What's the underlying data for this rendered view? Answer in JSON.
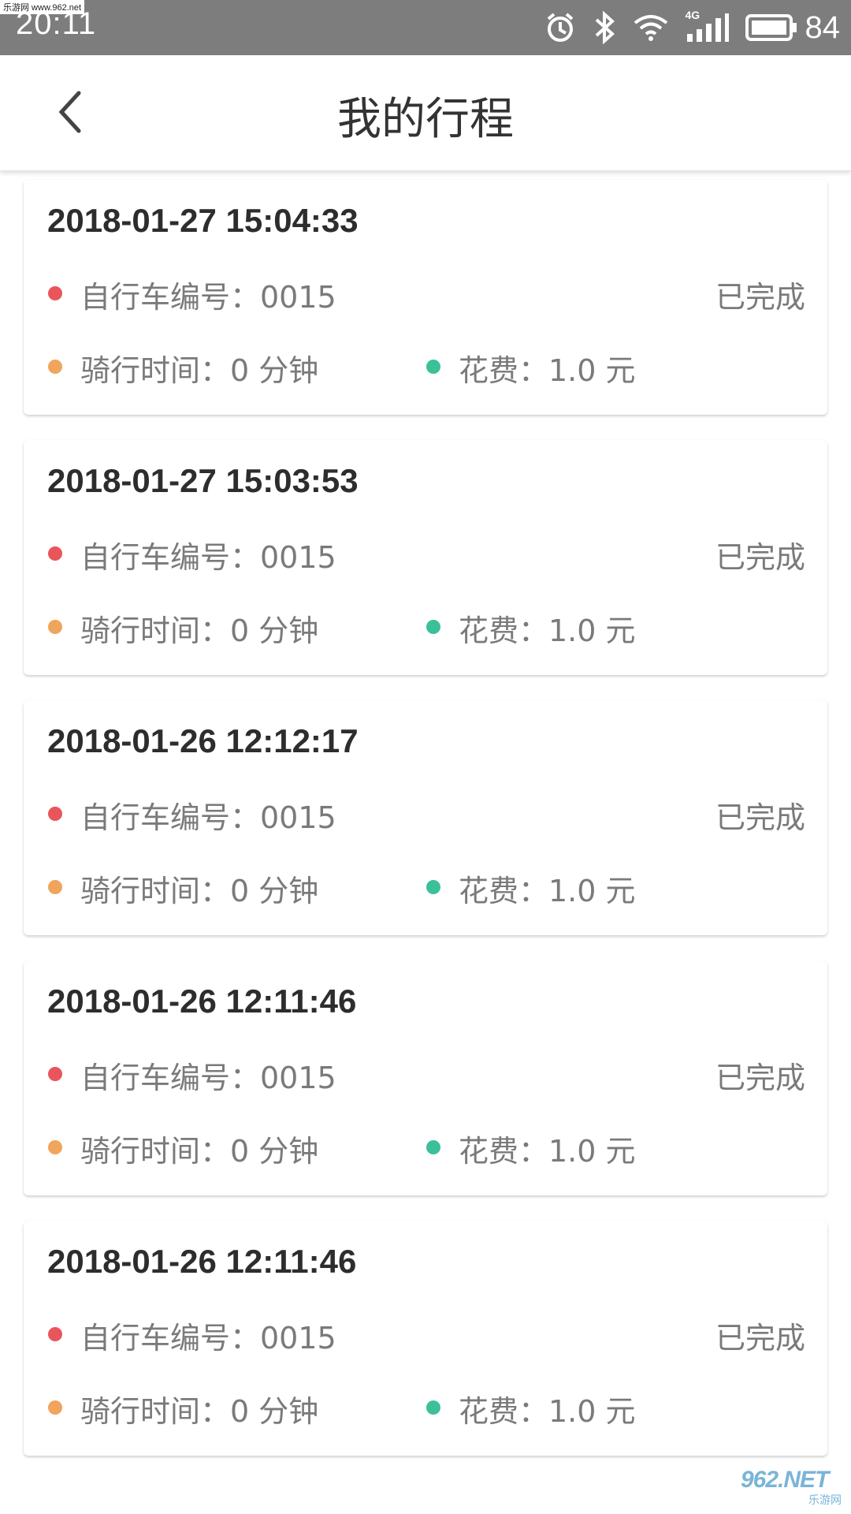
{
  "status_bar": {
    "time": "20:11",
    "battery_level": "84",
    "network_type": "4G",
    "icons": [
      "alarm-icon",
      "bluetooth-icon",
      "wifi-icon",
      "signal-icon",
      "battery-icon"
    ],
    "watermark": "乐游网 www.962.net"
  },
  "header": {
    "title": "我的行程",
    "back_icon": "chevron-left-icon"
  },
  "trips": [
    {
      "datetime": "2018-01-27 15:04:33",
      "bike_number": "自行车编号：0015",
      "status": "已完成",
      "duration": "骑行时间：0 分钟",
      "cost": "花费：1.0 元"
    },
    {
      "datetime": "2018-01-27 15:03:53",
      "bike_number": "自行车编号：0015",
      "status": "已完成",
      "duration": "骑行时间：0 分钟",
      "cost": "花费：1.0 元"
    },
    {
      "datetime": "2018-01-26 12:12:17",
      "bike_number": "自行车编号：0015",
      "status": "已完成",
      "duration": "骑行时间：0 分钟",
      "cost": "花费：1.0 元"
    },
    {
      "datetime": "2018-01-26 12:11:46",
      "bike_number": "自行车编号：0015",
      "status": "已完成",
      "duration": "骑行时间：0 分钟",
      "cost": "花费：1.0 元"
    },
    {
      "datetime": "2018-01-26 12:11:46",
      "bike_number": "自行车编号：0015",
      "status": "已完成",
      "duration": "骑行时间：0 分钟",
      "cost": "花费：1.0 元"
    }
  ],
  "colors": {
    "status_bar_bg": "#7d7d7d",
    "bike_dot": "#e8555a",
    "duration_dot": "#f0a45c",
    "cost_dot": "#3cc09a",
    "title_text": "#333333",
    "secondary_text": "#7a7a7a"
  },
  "watermark_logo": {
    "main": "962.NET",
    "sub": "乐游网"
  }
}
